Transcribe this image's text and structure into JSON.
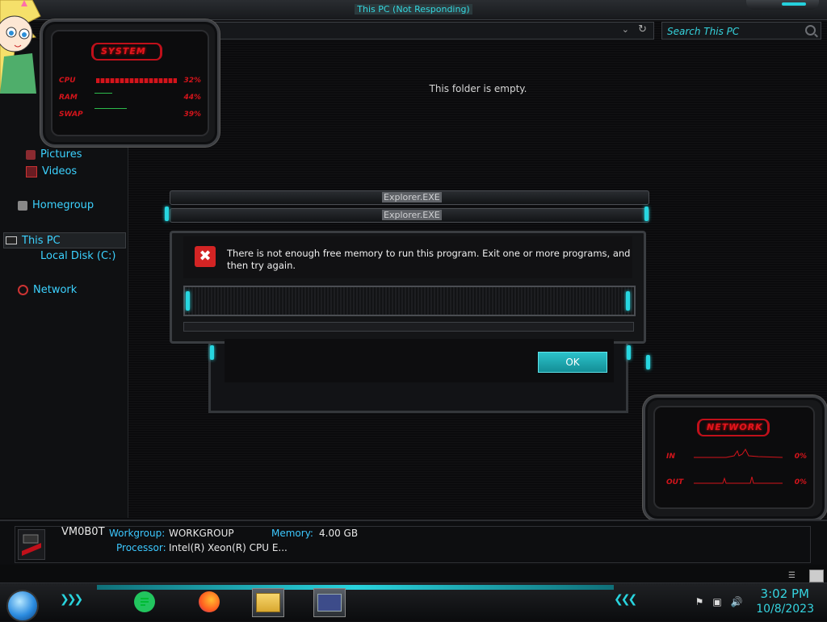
{
  "window": {
    "title": "This PC (Not Responding)",
    "search_placeholder": "Search This PC",
    "empty_message": "This folder is empty."
  },
  "sidebar": {
    "items": [
      {
        "label": "Pictures",
        "icon": "pictures-icon"
      },
      {
        "label": "Videos",
        "icon": "videos-icon"
      },
      {
        "label": "Homegroup",
        "icon": "homegroup-icon"
      },
      {
        "label": "This PC",
        "icon": "computer-icon",
        "selected": true
      },
      {
        "label": "Local Disk (C:)",
        "icon": "drive-icon"
      },
      {
        "label": "Network",
        "icon": "network-icon"
      }
    ]
  },
  "system_gadget": {
    "title": "SYSTEM",
    "cpu_label": "CPU",
    "cpu_value": "32%",
    "ram_label": "RAM",
    "ram_value": "44%",
    "swap_label": "SWAP",
    "swap_value": "39%"
  },
  "network_gadget": {
    "title": "NETWORK",
    "in_label": "IN",
    "in_value": "0%",
    "out_label": "OUT",
    "out_value": "0%"
  },
  "dialog": {
    "ghost_title_1": "Explorer.EXE",
    "ghost_title_2": "Explorer.EXE",
    "message": "There is not enough free memory to run this program. Exit one or more programs, and then try again.",
    "ok_label": "OK"
  },
  "details": {
    "computer_name": "VM0B0T",
    "workgroup_label": "Workgroup:",
    "workgroup_value": "WORKGROUP",
    "memory_label": "Memory:",
    "memory_value": "4.00 GB",
    "processor_label": "Processor:",
    "processor_value": "Intel(R) Xeon(R) CPU E..."
  },
  "taskbar": {
    "apps": [
      "notes-app-icon",
      "firefox-icon",
      "file-explorer-icon",
      "control-panel-icon"
    ],
    "time": "3:02 PM",
    "date": "10/8/2023",
    "accent": "#29d3dd"
  },
  "colors": {
    "accent_cyan": "#29d3dd",
    "gadget_red": "#d3141b",
    "error_red": "#d32424"
  }
}
